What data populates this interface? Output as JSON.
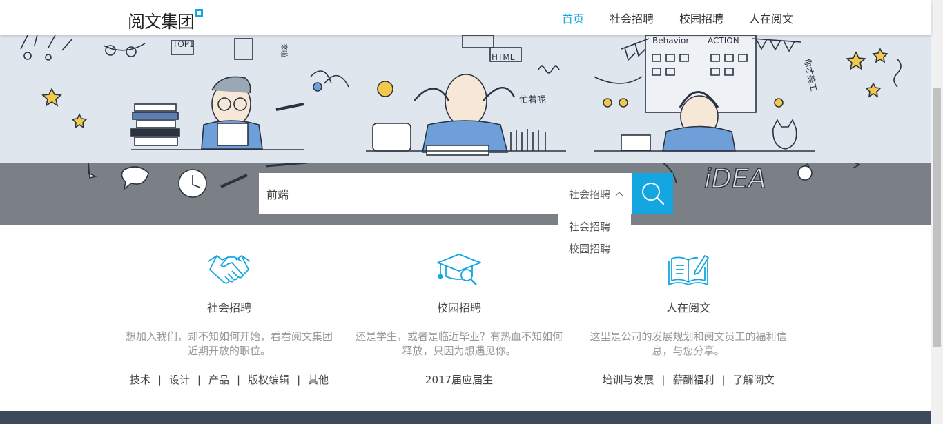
{
  "header": {
    "logo_text": "阅文集团",
    "nav": [
      {
        "label": "首页",
        "active": true
      },
      {
        "label": "社会招聘",
        "active": false
      },
      {
        "label": "校园招聘",
        "active": false
      },
      {
        "label": "人在阅文",
        "active": false
      }
    ]
  },
  "illustration": {
    "labels": [
      "TOP1",
      "HTML",
      "Behavior",
      "ACTION",
      "iDEA",
      "忙着呢",
      "你才美工",
      "来啦"
    ]
  },
  "search": {
    "value": "前端",
    "type_selected": "社会招聘",
    "options": [
      "社会招聘",
      "校园招聘"
    ]
  },
  "columns": [
    {
      "title": "社会招聘",
      "desc": "想加入我们，却不知如何开始，看看阅文集团近期开放的职位。",
      "links": [
        "技术",
        "设计",
        "产品",
        "版权编辑",
        "其他"
      ]
    },
    {
      "title": "校园招聘",
      "desc": "还是学生，或者是临近毕业？有热血不知如何释放，只因为想遇见你。",
      "links": [
        "2017届应届生"
      ]
    },
    {
      "title": "人在阅文",
      "desc": "这里是公司的发展规划和阅文员工的福利信息，与您分享。",
      "links": [
        "培训与发展",
        "薪酬福利",
        "了解阅文"
      ]
    }
  ],
  "colors": {
    "accent": "#14a6e0",
    "band": "#7b8086",
    "hero_bg": "#dfe6ee",
    "footer": "#3d4a5b"
  }
}
